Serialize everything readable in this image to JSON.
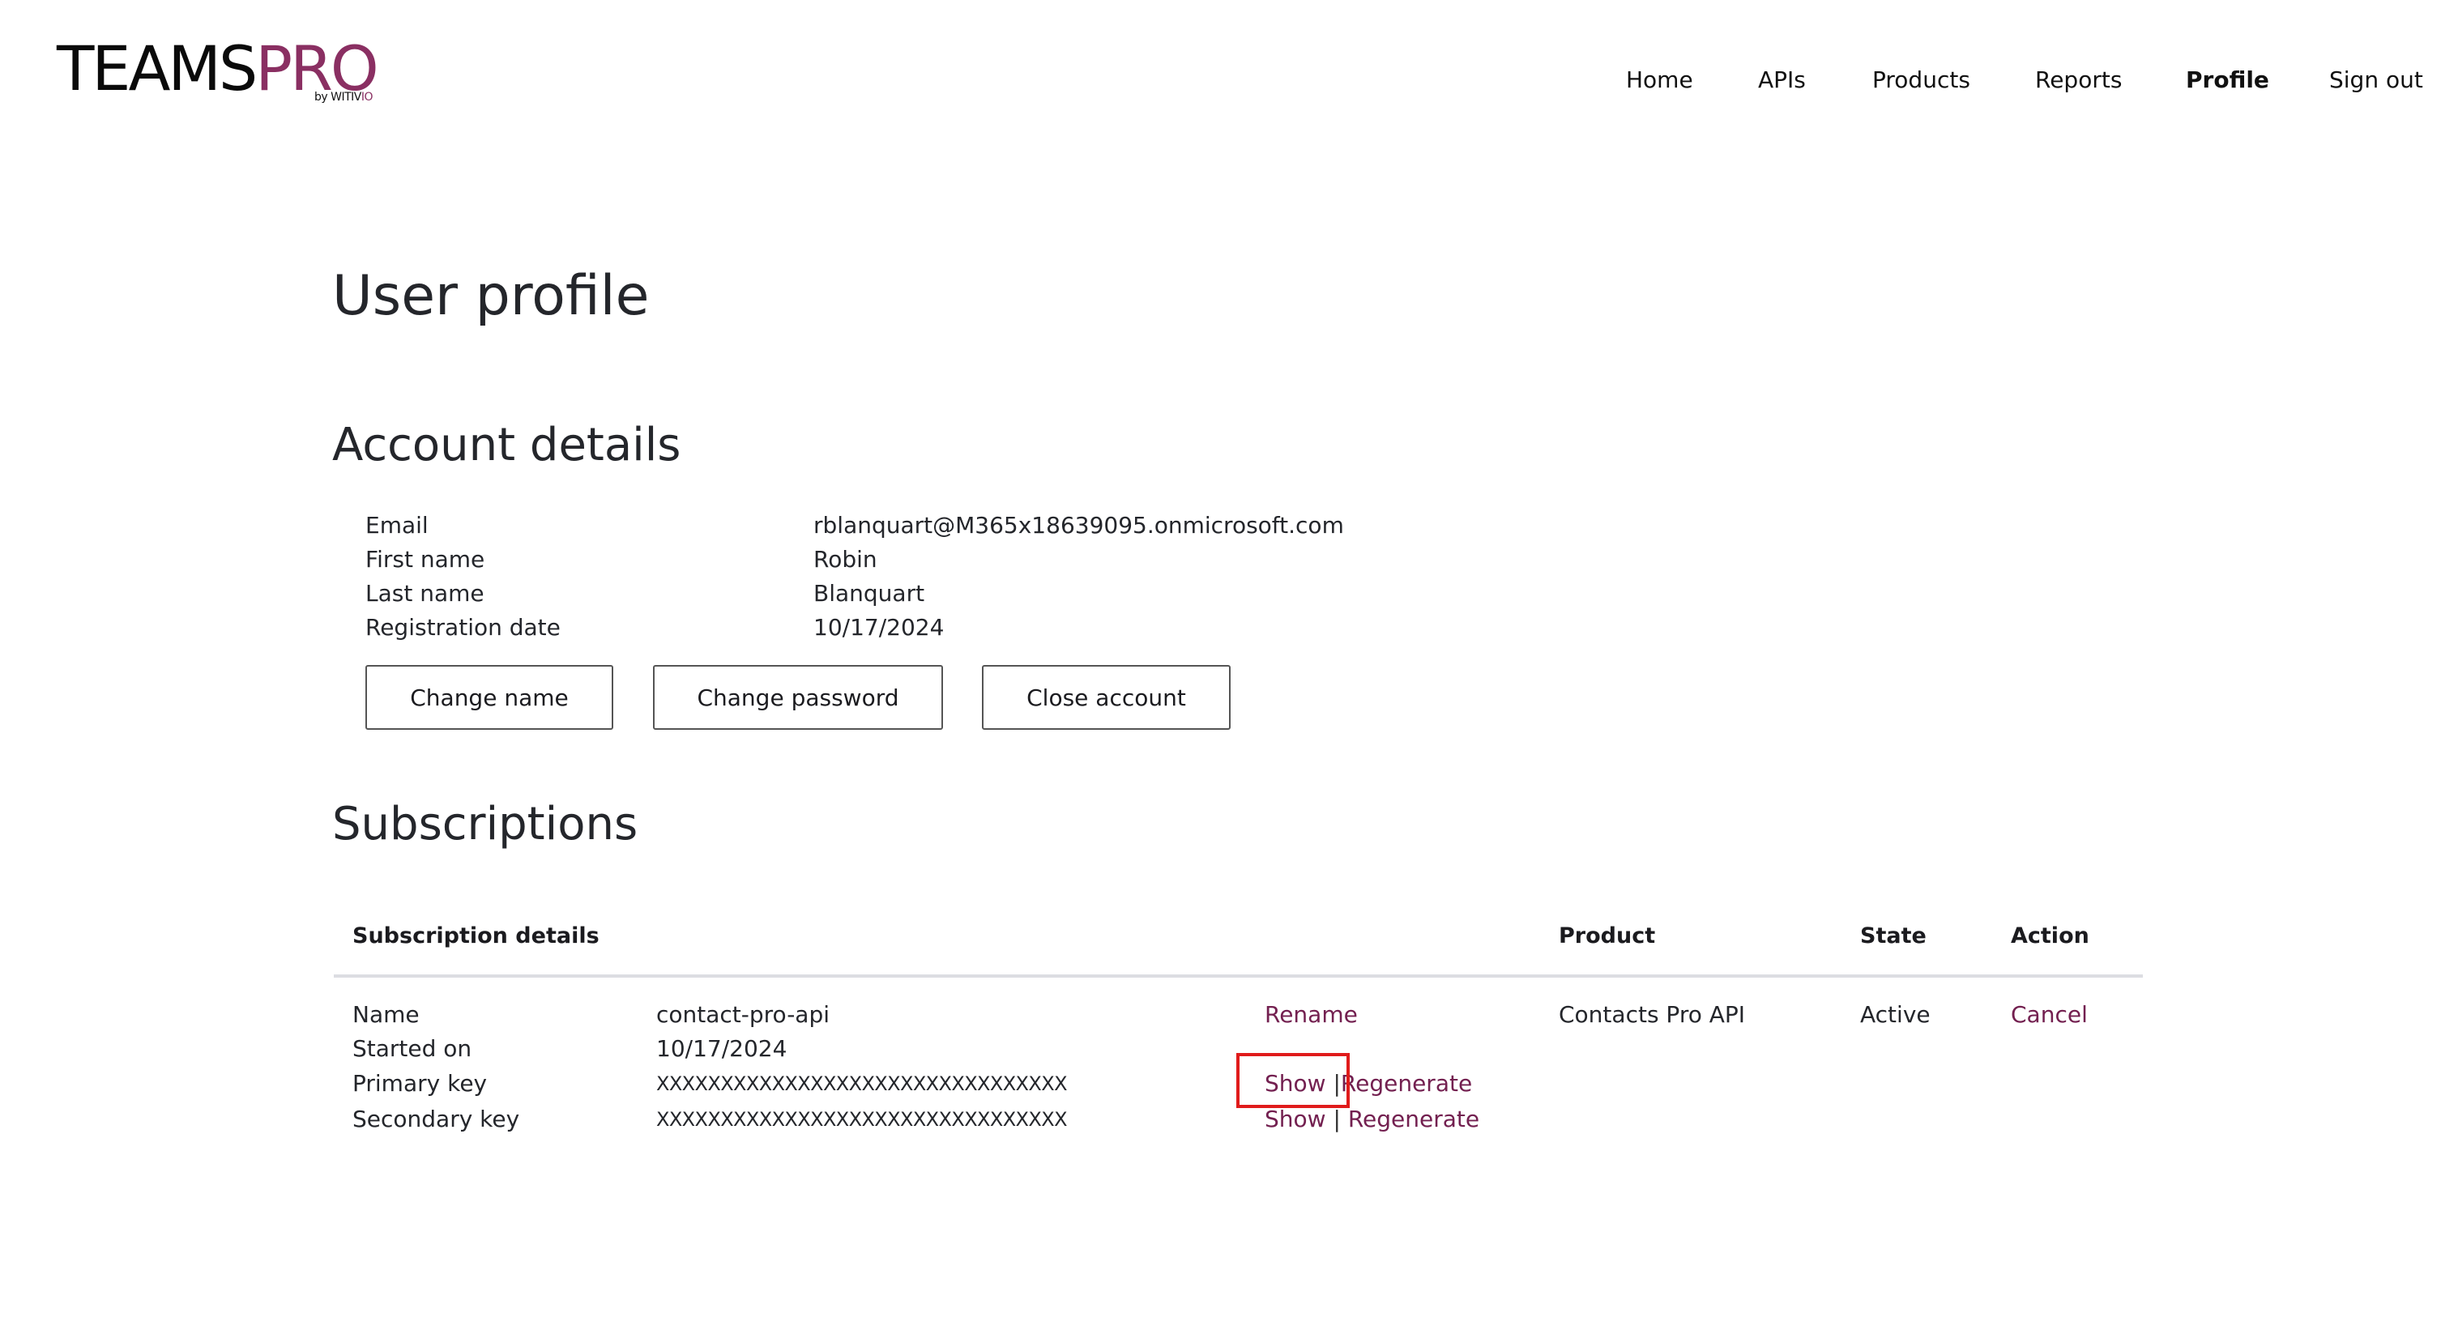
{
  "brand": {
    "logo_part1": "TEAMS",
    "logo_part2": "PRO",
    "tagline_prefix": "by WITIV",
    "tagline_suffix": "IO",
    "accent_color": "#8a2f62"
  },
  "nav": {
    "items": [
      {
        "label": "Home",
        "active": false
      },
      {
        "label": "APIs",
        "active": false
      },
      {
        "label": "Products",
        "active": false
      },
      {
        "label": "Reports",
        "active": false
      },
      {
        "label": "Profile",
        "active": true
      },
      {
        "label": "Sign out",
        "active": false
      }
    ]
  },
  "page": {
    "title": "User profile"
  },
  "account": {
    "heading": "Account details",
    "fields": [
      {
        "label": "Email",
        "value": "rblanquart@M365x18639095.onmicrosoft.com"
      },
      {
        "label": "First name",
        "value": "Robin"
      },
      {
        "label": "Last name",
        "value": "Blanquart"
      },
      {
        "label": "Registration date",
        "value": "10/17/2024"
      }
    ],
    "buttons": {
      "change_name": "Change name",
      "change_password": "Change password",
      "close_account": "Close account"
    }
  },
  "subscriptions": {
    "heading": "Subscriptions",
    "columns": {
      "details": "Subscription details",
      "product": "Product",
      "state": "State",
      "action": "Action"
    },
    "items": [
      {
        "name_label": "Name",
        "name": "contact-pro-api",
        "rename": "Rename",
        "started_label": "Started on",
        "started": "10/17/2024",
        "primary_label": "Primary key",
        "primary_key": "XXXXXXXXXXXXXXXXXXXXXXXXXXXXXXXX",
        "secondary_label": "Secondary key",
        "secondary_key": "XXXXXXXXXXXXXXXXXXXXXXXXXXXXXXXX",
        "show": "Show",
        "separator": "|",
        "regenerate": "Regenerate",
        "product": "Contacts Pro API",
        "state": "Active",
        "action": "Cancel"
      }
    ]
  },
  "colors": {
    "link": "#732050",
    "highlight_box": "#e01b1b",
    "table_rule": "#dcdde2"
  }
}
